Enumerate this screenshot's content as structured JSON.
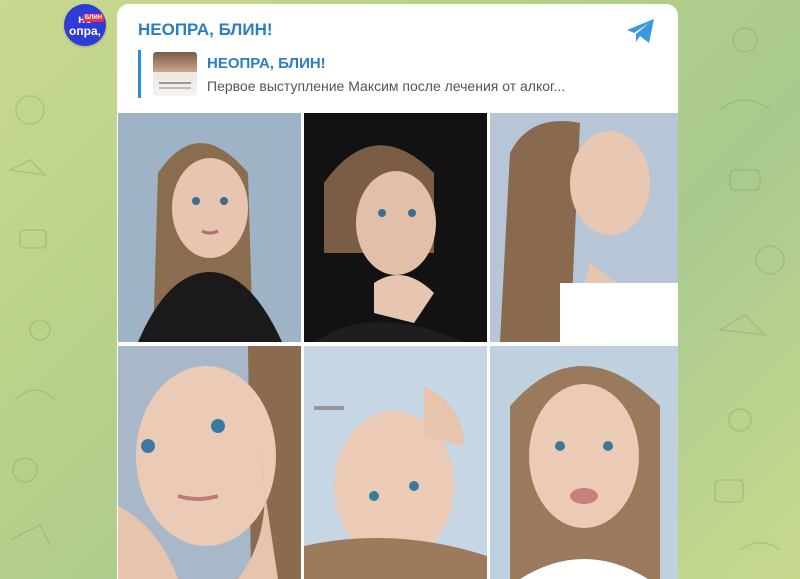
{
  "channel": {
    "avatar_text_line1": "не",
    "avatar_text_line2": "опра,",
    "avatar_badge": "БЛИН",
    "name": "НЕОПРА, БЛИН!"
  },
  "reply": {
    "title": "НЕОПРА, БЛИН!",
    "snippet": "Первое выступление Максим после лечения от алког..."
  },
  "photos": [
    {
      "name": "photo-1",
      "bg": "#9eb4c6"
    },
    {
      "name": "photo-2",
      "bg": "#121212"
    },
    {
      "name": "photo-3",
      "bg": "#b6c6d6"
    },
    {
      "name": "photo-4",
      "bg": "#a9b8c8"
    },
    {
      "name": "photo-5",
      "bg": "#c7d6e4"
    },
    {
      "name": "photo-6",
      "bg": "#bfd0df"
    }
  ],
  "colors": {
    "accent": "#2a7fc4",
    "reply_bar": "#2a8fd6",
    "share_icon": "#3a9ae0"
  },
  "icons": {
    "share": "telegram-plane-icon"
  }
}
